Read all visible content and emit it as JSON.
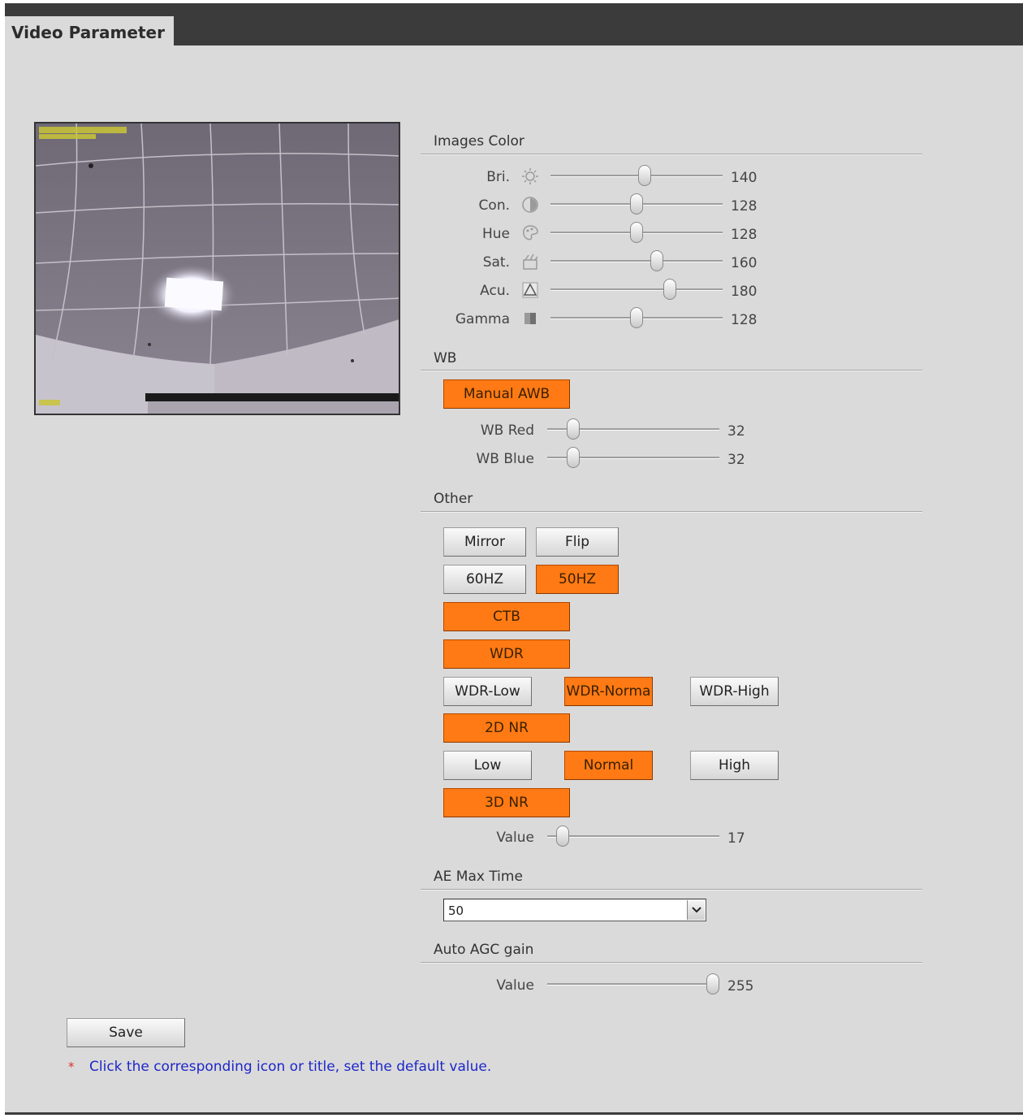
{
  "header": {
    "tab_title": "Video Parameter"
  },
  "images_color": {
    "title": "Images Color",
    "rows": [
      {
        "label": "Bri.",
        "icon": "brightness-icon",
        "value": "140"
      },
      {
        "label": "Con.",
        "icon": "contrast-icon",
        "value": "128"
      },
      {
        "label": "Hue",
        "icon": "hue-icon",
        "value": "128"
      },
      {
        "label": "Sat.",
        "icon": "saturation-icon",
        "value": "160"
      },
      {
        "label": "Acu.",
        "icon": "acutance-icon",
        "value": "180"
      },
      {
        "label": "Gamma",
        "icon": "gamma-icon",
        "value": "128"
      }
    ]
  },
  "wb": {
    "title": "WB",
    "awb_button": "Manual AWB",
    "rows": [
      {
        "label": "WB Red",
        "value": "32"
      },
      {
        "label": "WB Blue",
        "value": "32"
      }
    ]
  },
  "other": {
    "title": "Other",
    "mirror": "Mirror",
    "flip": "Flip",
    "hz60": "60HZ",
    "hz50": "50HZ",
    "ctb": "CTB",
    "wdr": "WDR",
    "wdr_low": "WDR-Low",
    "wdr_normal": "WDR-Norma",
    "wdr_high": "WDR-High",
    "nr2d": "2D NR",
    "low": "Low",
    "normal": "Normal",
    "high": "High",
    "nr3d": "3D NR",
    "value_label": "Value",
    "value": "17"
  },
  "ae": {
    "title": "AE Max Time",
    "selected": "50"
  },
  "agc": {
    "title": "Auto AGC gain",
    "value_label": "Value",
    "value": "255"
  },
  "footer": {
    "save": "Save",
    "star": "*",
    "note": "Click the corresponding icon or title, set the default value."
  },
  "colors": {
    "accent": "#ff7a14",
    "note": "#1e27c8",
    "star": "#e0312c",
    "topbar": "#3b3b3b",
    "background": "#dadada"
  }
}
